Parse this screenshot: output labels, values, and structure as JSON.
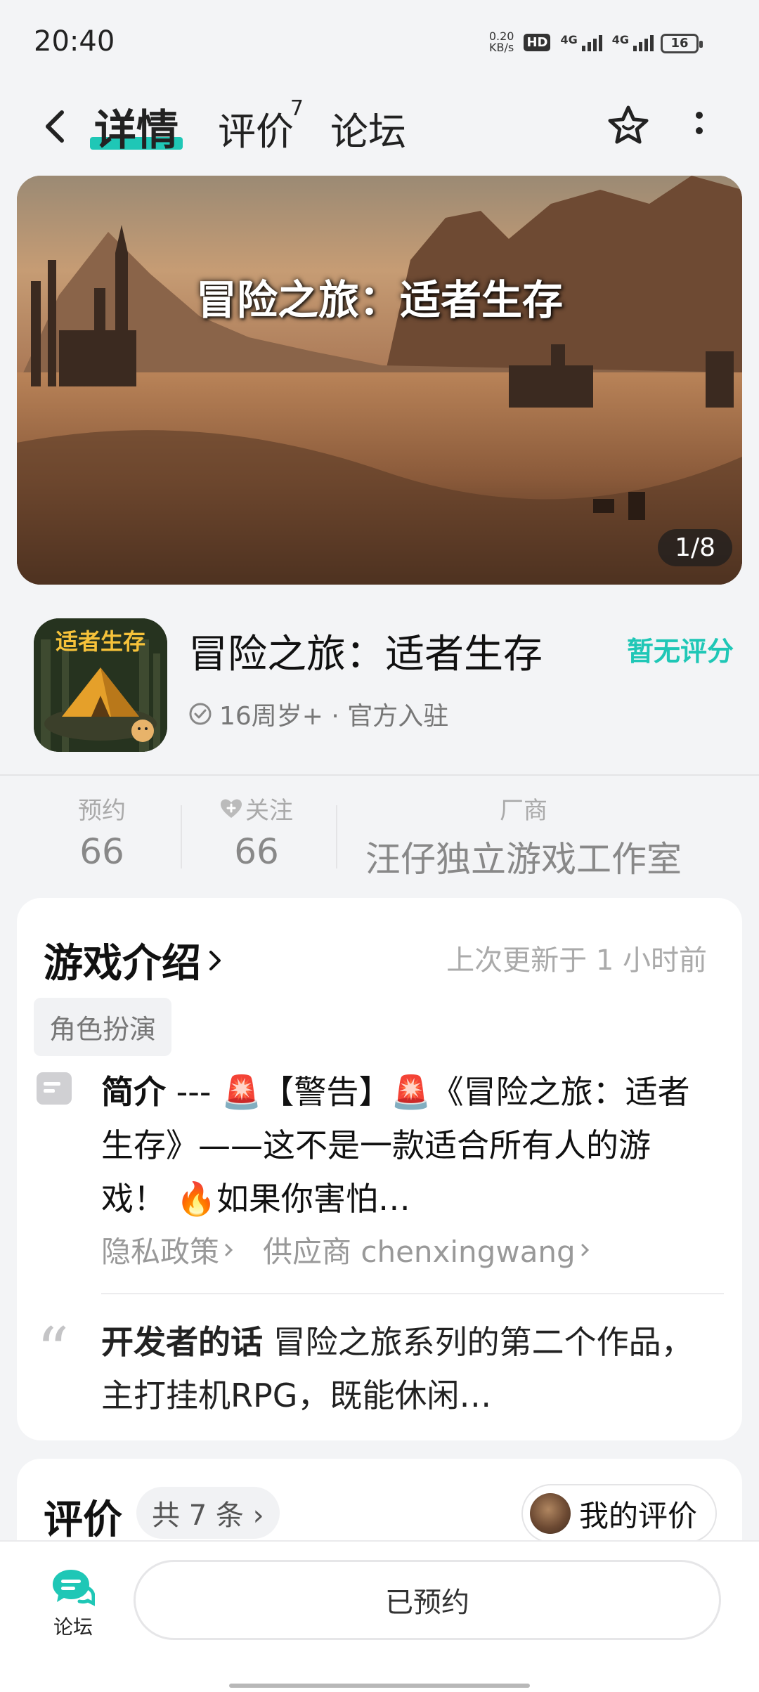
{
  "status_bar": {
    "time": "20:40",
    "net_speed_value": "0.20",
    "net_speed_unit": "KB/s",
    "hd_badge": "HD",
    "sim1": "1",
    "sim2": "2",
    "signal1_label": "4G",
    "signal2_label": "4G",
    "battery": "16"
  },
  "header": {
    "tab_detail": "详情",
    "tab_review": "评价",
    "tab_review_count": "7",
    "tab_forum": "论坛"
  },
  "banner": {
    "title": "冒险之旅：适者生存",
    "counter": "1/8"
  },
  "game": {
    "icon_text": "适者生存",
    "name": "冒险之旅：适者生存",
    "score_status": "暂无评分",
    "meta": "16周岁+ · 官方入驻"
  },
  "stats": {
    "reserve_label": "预约",
    "reserve_value": "66",
    "follow_label": "关注",
    "follow_value": "66",
    "vendor_label": "厂商",
    "vendor_value": "汪仔独立游戏工作室"
  },
  "intro": {
    "title": "游戏介绍",
    "updated": "上次更新于 1 小时前",
    "tag": "角色扮演",
    "summary_label": "简介",
    "summary_text": " --- 🚨【警告】🚨《冒险之旅：适者生存》——这不是一款适合所有人的游戏！ 🔥如果你害怕…",
    "privacy_link": "隐私政策",
    "supplier_link": "供应商 chenxingwang",
    "dev_label": "开发者的话",
    "dev_text": " 冒险之旅系列的第二个作品，主打挂机RPG，既能休闲…"
  },
  "reviews": {
    "title": "评价",
    "count": "共 7 条",
    "my_review": "我的评价"
  },
  "bottom": {
    "forum_label": "论坛",
    "reserve_button": "已预约"
  },
  "colors": {
    "accent": "#1fc7b6",
    "background": "#f3f4f6"
  }
}
